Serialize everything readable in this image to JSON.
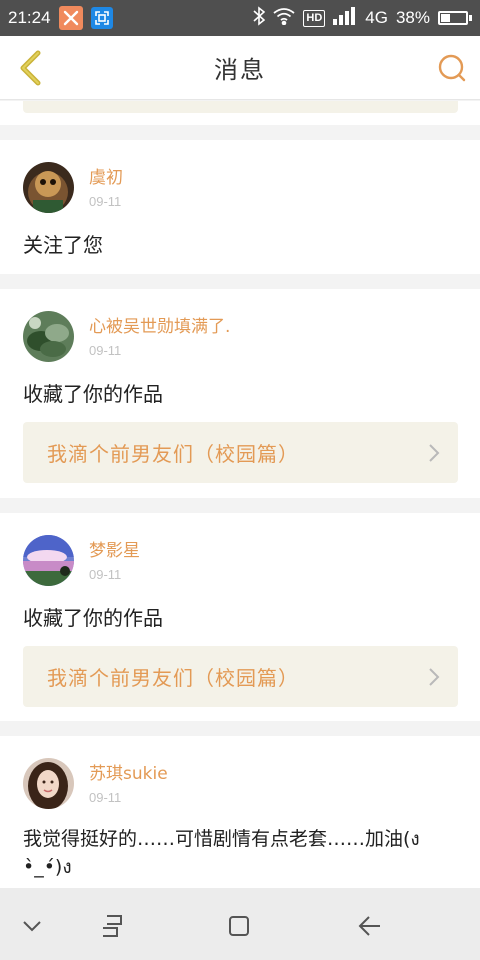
{
  "status_bar": {
    "time": "21:24",
    "network": "4G",
    "hd": "HD",
    "battery_text": "38%",
    "battery_level": 0.38,
    "icons": [
      "xiaomi-app-icon",
      "screenshot-app-icon",
      "bluetooth-icon",
      "wifi-icon",
      "hd-icon",
      "signal-icon",
      "battery-icon"
    ]
  },
  "header": {
    "title": "消息",
    "back_icon": "back-chevron-icon",
    "search_icon": "search-icon"
  },
  "colors": {
    "accent": "#e39a55",
    "work_bg": "#f4f2e8",
    "status_bar": "#4f4f4f",
    "back_arrow": "#c9b238"
  },
  "messages": [
    {
      "username": "虞初",
      "date": "09-11",
      "action": "关注了您"
    },
    {
      "username": "心被吴世勋填满了.",
      "date": "09-11",
      "action": "收藏了你的作品",
      "work_title": "我滴个前男友们（校园篇）"
    },
    {
      "username": "梦影星",
      "date": "09-11",
      "action": "收藏了你的作品",
      "work_title": "我滴个前男友们（校园篇）"
    },
    {
      "username": "苏琪sukie",
      "date": "09-11",
      "comment": "我觉得挺好的……可惜剧情有点老套……加油(ง •̀_•́)ง"
    }
  ],
  "nav_bar": {
    "icons": [
      "collapse-chevron-icon",
      "recent-apps-icon",
      "home-icon",
      "back-arrow-icon"
    ]
  }
}
